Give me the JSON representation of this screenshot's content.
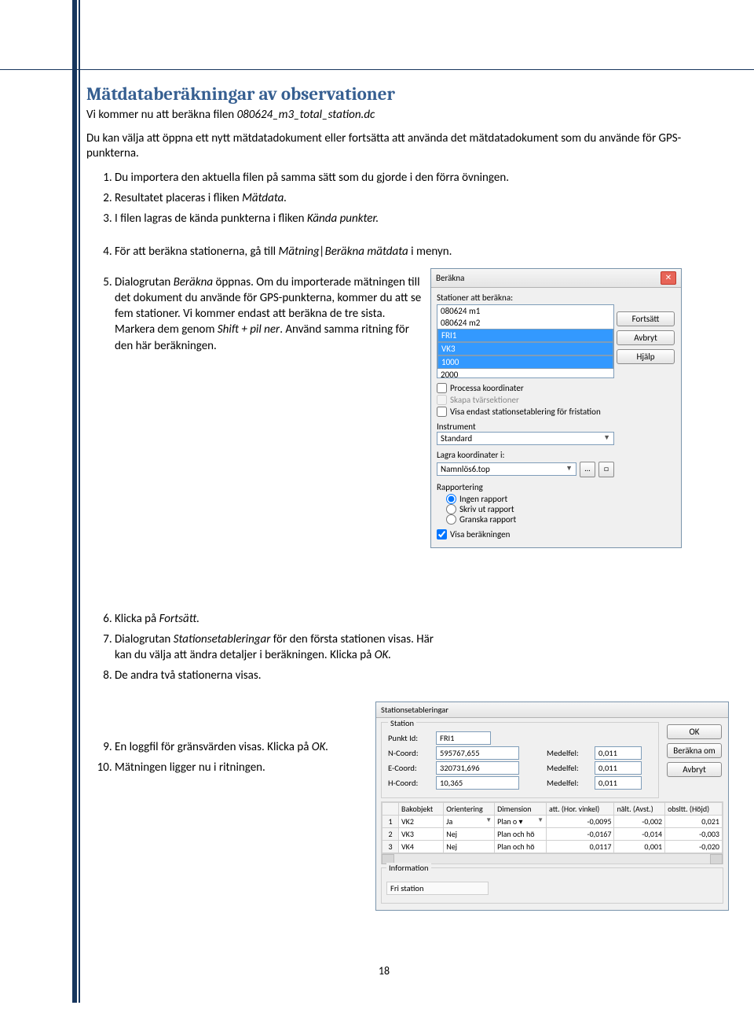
{
  "doc": {
    "heading": "Mätdataberäkningar av observationer",
    "intro1_a": "Vi kommer nu att beräkna filen ",
    "intro1_file": "080624_m3_total_station.dc",
    "intro2": "Du kan välja att öppna ett nytt mätdatadokument eller fortsätta att använda det mätdatadokument som du använde för GPS-punkterna.",
    "step1": "Du importera den aktuella filen på samma sätt som du gjorde i den förra övningen.",
    "step2_a": "Resultatet placeras i fliken ",
    "step2_em": "Mätdata.",
    "step3_a": "I filen lagras de kända punkterna i fliken ",
    "step3_em": "Kända punkter.",
    "step4_a": "För att beräkna stationerna, gå till ",
    "step4_em": "Mätning|Beräkna mätdata",
    "step4_b": " i menyn.",
    "step5_a": "Dialogrutan ",
    "step5_em": "Beräkna",
    "step5_b": " öppnas. Om du importerade mätningen till det dokument du använde för GPS-punkterna, kommer du att se fem stationer.",
    "step5_c": "Vi kommer endast att beräkna de tre sista. Markera dem genom ",
    "step5_em2": "Shift + pil ner",
    "step5_d": ". Använd samma ritning för den här beräkningen.",
    "step6_a": "Klicka på ",
    "step6_em": "Fortsätt.",
    "step7_a": "Dialogrutan ",
    "step7_em": "Stationsetableringar",
    "step7_b": " för den första stationen visas. Här kan du välja att ändra detaljer i beräkningen. Klicka på ",
    "step7_em2": "OK.",
    "step8": "De andra två stationerna visas.",
    "step9_a": "En loggfil för gränsvärden visas. Klicka på ",
    "step9_em": "OK.",
    "step10": "Mätningen ligger nu i ritningen.",
    "page_number": "18"
  },
  "dlg1": {
    "title": "Beräkna",
    "stations_label": "Stationer att beräkna:",
    "items": [
      "080624 m1",
      "080624 m2",
      "FRI1",
      "VK3",
      "1000",
      "2000"
    ],
    "btn_fortsatt": "Fortsätt",
    "btn_avbryt": "Avbryt",
    "btn_hjalp": "Hjälp",
    "chk_processa": "Processa koordinater",
    "chk_skapa": "Skapa tvärsektioner",
    "chk_visa_endast": "Visa endast stationsetablering för fristation",
    "instrument_label": "Instrument",
    "instrument_value": "Standard",
    "lagra_label": "Lagra koordinater i:",
    "lagra_value": "Namnlös6.top",
    "rapportering": "Rapportering",
    "radio_ingen": "Ingen rapport",
    "radio_skriv": "Skriv ut rapport",
    "radio_granska": "Granska rapport",
    "chk_visa_berakning": "Visa beräkningen"
  },
  "dlg2": {
    "title": "Stationsetableringar",
    "group_station": "Station",
    "punkt_id_label": "Punkt Id:",
    "punkt_id_value": "FRI1",
    "n_label": "N-Coord:",
    "n_value": "595767,655",
    "e_label": "E-Coord:",
    "e_value": "320731,696",
    "h_label": "H-Coord:",
    "h_value": "10,365",
    "medelfel_label": "Medelfel:",
    "mf_n": "0,011",
    "mf_e": "0,011",
    "mf_h": "0,011",
    "btn_ok": "OK",
    "btn_berakna_om": "Beräkna om",
    "btn_avbryt": "Avbryt",
    "cols": [
      "",
      "Bakobjekt",
      "Orientering",
      "Dimension",
      "att. (Hor. vinkel)",
      "nält. (Avst.)",
      "obsltt. (Höjd)"
    ],
    "rows": [
      {
        "n": "1",
        "bak": "VK2",
        "ori": "Ja",
        "dim": "Plan o ▾",
        "hv": "-0,0095",
        "avst": "-0,002",
        "hojd": "0,021"
      },
      {
        "n": "2",
        "bak": "VK3",
        "ori": "Nej",
        "dim": "Plan och hö",
        "hv": "-0,0167",
        "avst": "-0,014",
        "hojd": "-0,003"
      },
      {
        "n": "3",
        "bak": "VK4",
        "ori": "Nej",
        "dim": "Plan och hö",
        "hv": "0,0117",
        "avst": "0,001",
        "hojd": "-0,020"
      }
    ],
    "info_label": "Information",
    "info_value": "Fri station"
  }
}
